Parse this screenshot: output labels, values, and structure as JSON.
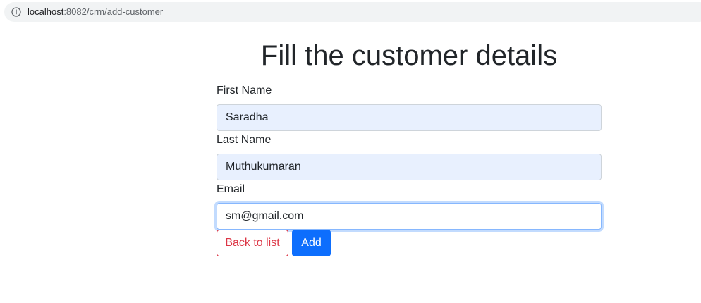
{
  "browser": {
    "url_host": "localhost",
    "url_path": ":8082/crm/add-customer"
  },
  "page": {
    "title": "Fill the customer details"
  },
  "form": {
    "first_name": {
      "label": "First Name",
      "value": "Saradha"
    },
    "last_name": {
      "label": "Last Name",
      "value": "Muthukumaran"
    },
    "email": {
      "label": "Email",
      "value": "sm@gmail.com"
    }
  },
  "buttons": {
    "back_label": "Back to list",
    "add_label": "Add"
  },
  "colors": {
    "autofill_bg": "#e8f0fe",
    "danger": "#dc3545",
    "primary": "#0d6efd"
  }
}
